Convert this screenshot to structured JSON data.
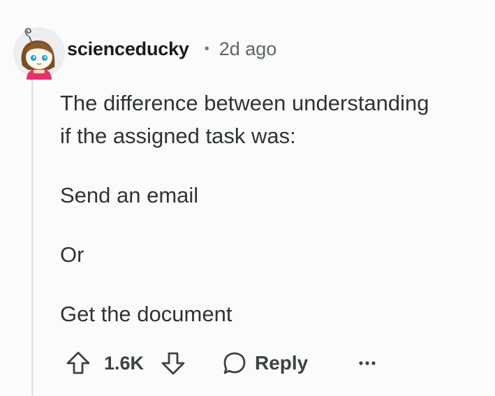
{
  "comment": {
    "author": "scienceducky",
    "separator": "•",
    "age": "2d ago",
    "body": [
      "The difference between understanding",
      "if the assigned task was:",
      "Send an email",
      "Or",
      "Get the document"
    ]
  },
  "actions": {
    "score": "1.6K",
    "reply_label": "Reply",
    "more_label": "···"
  },
  "colors": {
    "background": "#fbfbfb",
    "thread_line": "#e2e5e8",
    "text": "#2f3436",
    "icon": "#3b4244"
  }
}
